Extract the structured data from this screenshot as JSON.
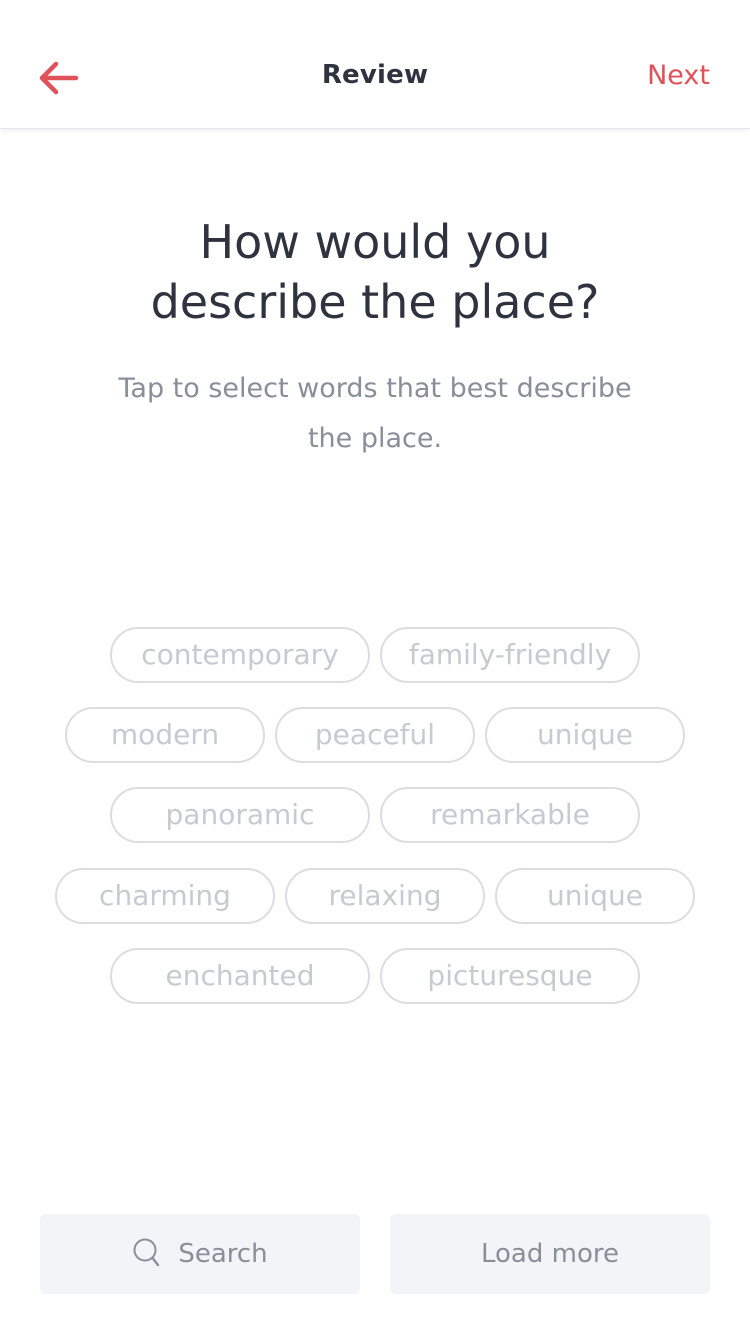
{
  "header": {
    "title": "Review",
    "next_label": "Next",
    "back_icon": "arrow-left-icon",
    "accent_color": "#e0525a"
  },
  "main": {
    "heading_line1": "How would you",
    "heading_line2": "describe the place?",
    "subheading": "Tap to select words that best describe the place."
  },
  "tags": [
    "contemporary",
    "family-friendly",
    "modern",
    "peaceful",
    "unique",
    "panoramic",
    "remarkable",
    "charming",
    "relaxing",
    "unique",
    "enchanted",
    "picturesque"
  ],
  "bottom": {
    "search_label": "Search",
    "search_icon": "search-icon",
    "load_more_label": "Load more"
  }
}
